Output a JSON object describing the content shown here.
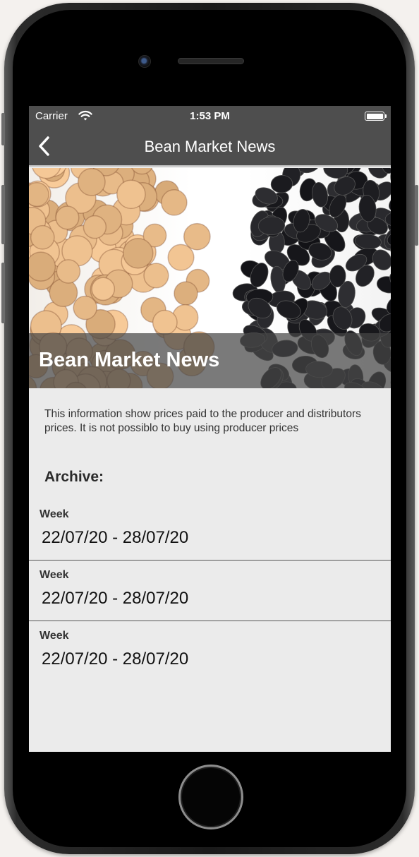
{
  "status_bar": {
    "carrier": "Carrier",
    "time": "1:53 PM"
  },
  "nav": {
    "title": "Bean Market News",
    "back_icon": "chevron-left-icon"
  },
  "banner": {
    "title": "Bean Market News"
  },
  "description": "This information show prices paid to the producer and distributors prices. It is not possiblo to buy using producer prices",
  "archive": {
    "heading": "Archive:",
    "weeks": [
      {
        "label": "Week",
        "range": "22/07/20 - 28/07/20"
      },
      {
        "label": "Week",
        "range": "22/07/20 - 28/07/20"
      },
      {
        "label": "Week",
        "range": "22/07/20 - 28/07/20"
      }
    ]
  },
  "colors": {
    "bar_background": "#4e4e4e",
    "screen_background": "#ebebeb",
    "chickpea": "#d9a07c",
    "black_bean": "#1c1c1c"
  }
}
